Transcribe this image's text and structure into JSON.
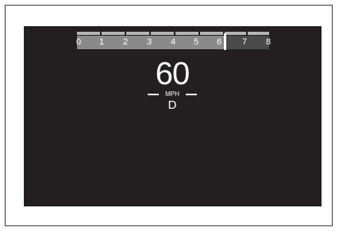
{
  "tachometer": {
    "labels": [
      "0",
      "1",
      "2",
      "3",
      "4",
      "5",
      "6",
      "7",
      "8"
    ],
    "max": 8,
    "current": 6.3,
    "lit_color": "#8a8a8a",
    "dim_color": "#4a4a4a"
  },
  "speed": {
    "value": "60",
    "unit": "MPH"
  },
  "gear": "D",
  "colors": {
    "screen_bg": "#231f20",
    "text": "#ffffff"
  }
}
